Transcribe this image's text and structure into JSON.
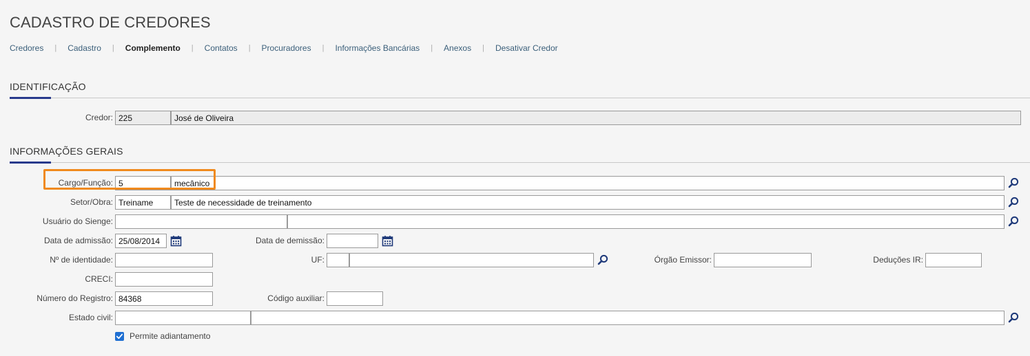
{
  "page": {
    "title": "CADASTRO DE CREDORES"
  },
  "tabs": [
    {
      "label": "Credores"
    },
    {
      "label": "Cadastro"
    },
    {
      "label": "Complemento",
      "active": true
    },
    {
      "label": "Contatos"
    },
    {
      "label": "Procuradores"
    },
    {
      "label": "Informações Bancárias"
    },
    {
      "label": "Anexos"
    },
    {
      "label": "Desativar Credor"
    }
  ],
  "identificacao": {
    "title": "IDENTIFICAÇÃO",
    "credor_label": "Credor:",
    "credor_code": "225",
    "credor_name": "José de Oliveira"
  },
  "gerais": {
    "title": "INFORMAÇÕES GERAIS",
    "cargo_label": "Cargo/Função:",
    "cargo_code": "5",
    "cargo_name": "mecânico",
    "setor_label": "Setor/Obra:",
    "setor_code": "Treiname",
    "setor_name": "Teste de necessidade de treinamento",
    "usuario_label": "Usuário do Sienge:",
    "usuario_code": "",
    "usuario_name": "",
    "admissao_label": "Data de admissão:",
    "admissao_value": "25/08/2014",
    "demissao_label": "Data de demissão:",
    "demissao_value": "",
    "identidade_label": "Nº de identidade:",
    "identidade_value": "",
    "uf_label": "UF:",
    "uf_code": "",
    "uf_name": "",
    "orgao_label": "Órgão Emissor:",
    "orgao_value": "",
    "deducoes_label": "Deduções IR:",
    "deducoes_value": "",
    "creci_label": "CRECI:",
    "creci_value": "",
    "registro_label": "Número do Registro:",
    "registro_value": "84368",
    "auxiliar_label": "Código auxiliar:",
    "auxiliar_value": "",
    "estado_label": "Estado civil:",
    "estado_code": "",
    "estado_name": "",
    "adiantamento_label": "Permite adiantamento",
    "adiantamento_checked": true
  },
  "colors": {
    "accent": "#283a8c",
    "highlight": "#f08a1d",
    "checkbox": "#1f6fd2",
    "icon": "#1f3a7a"
  }
}
